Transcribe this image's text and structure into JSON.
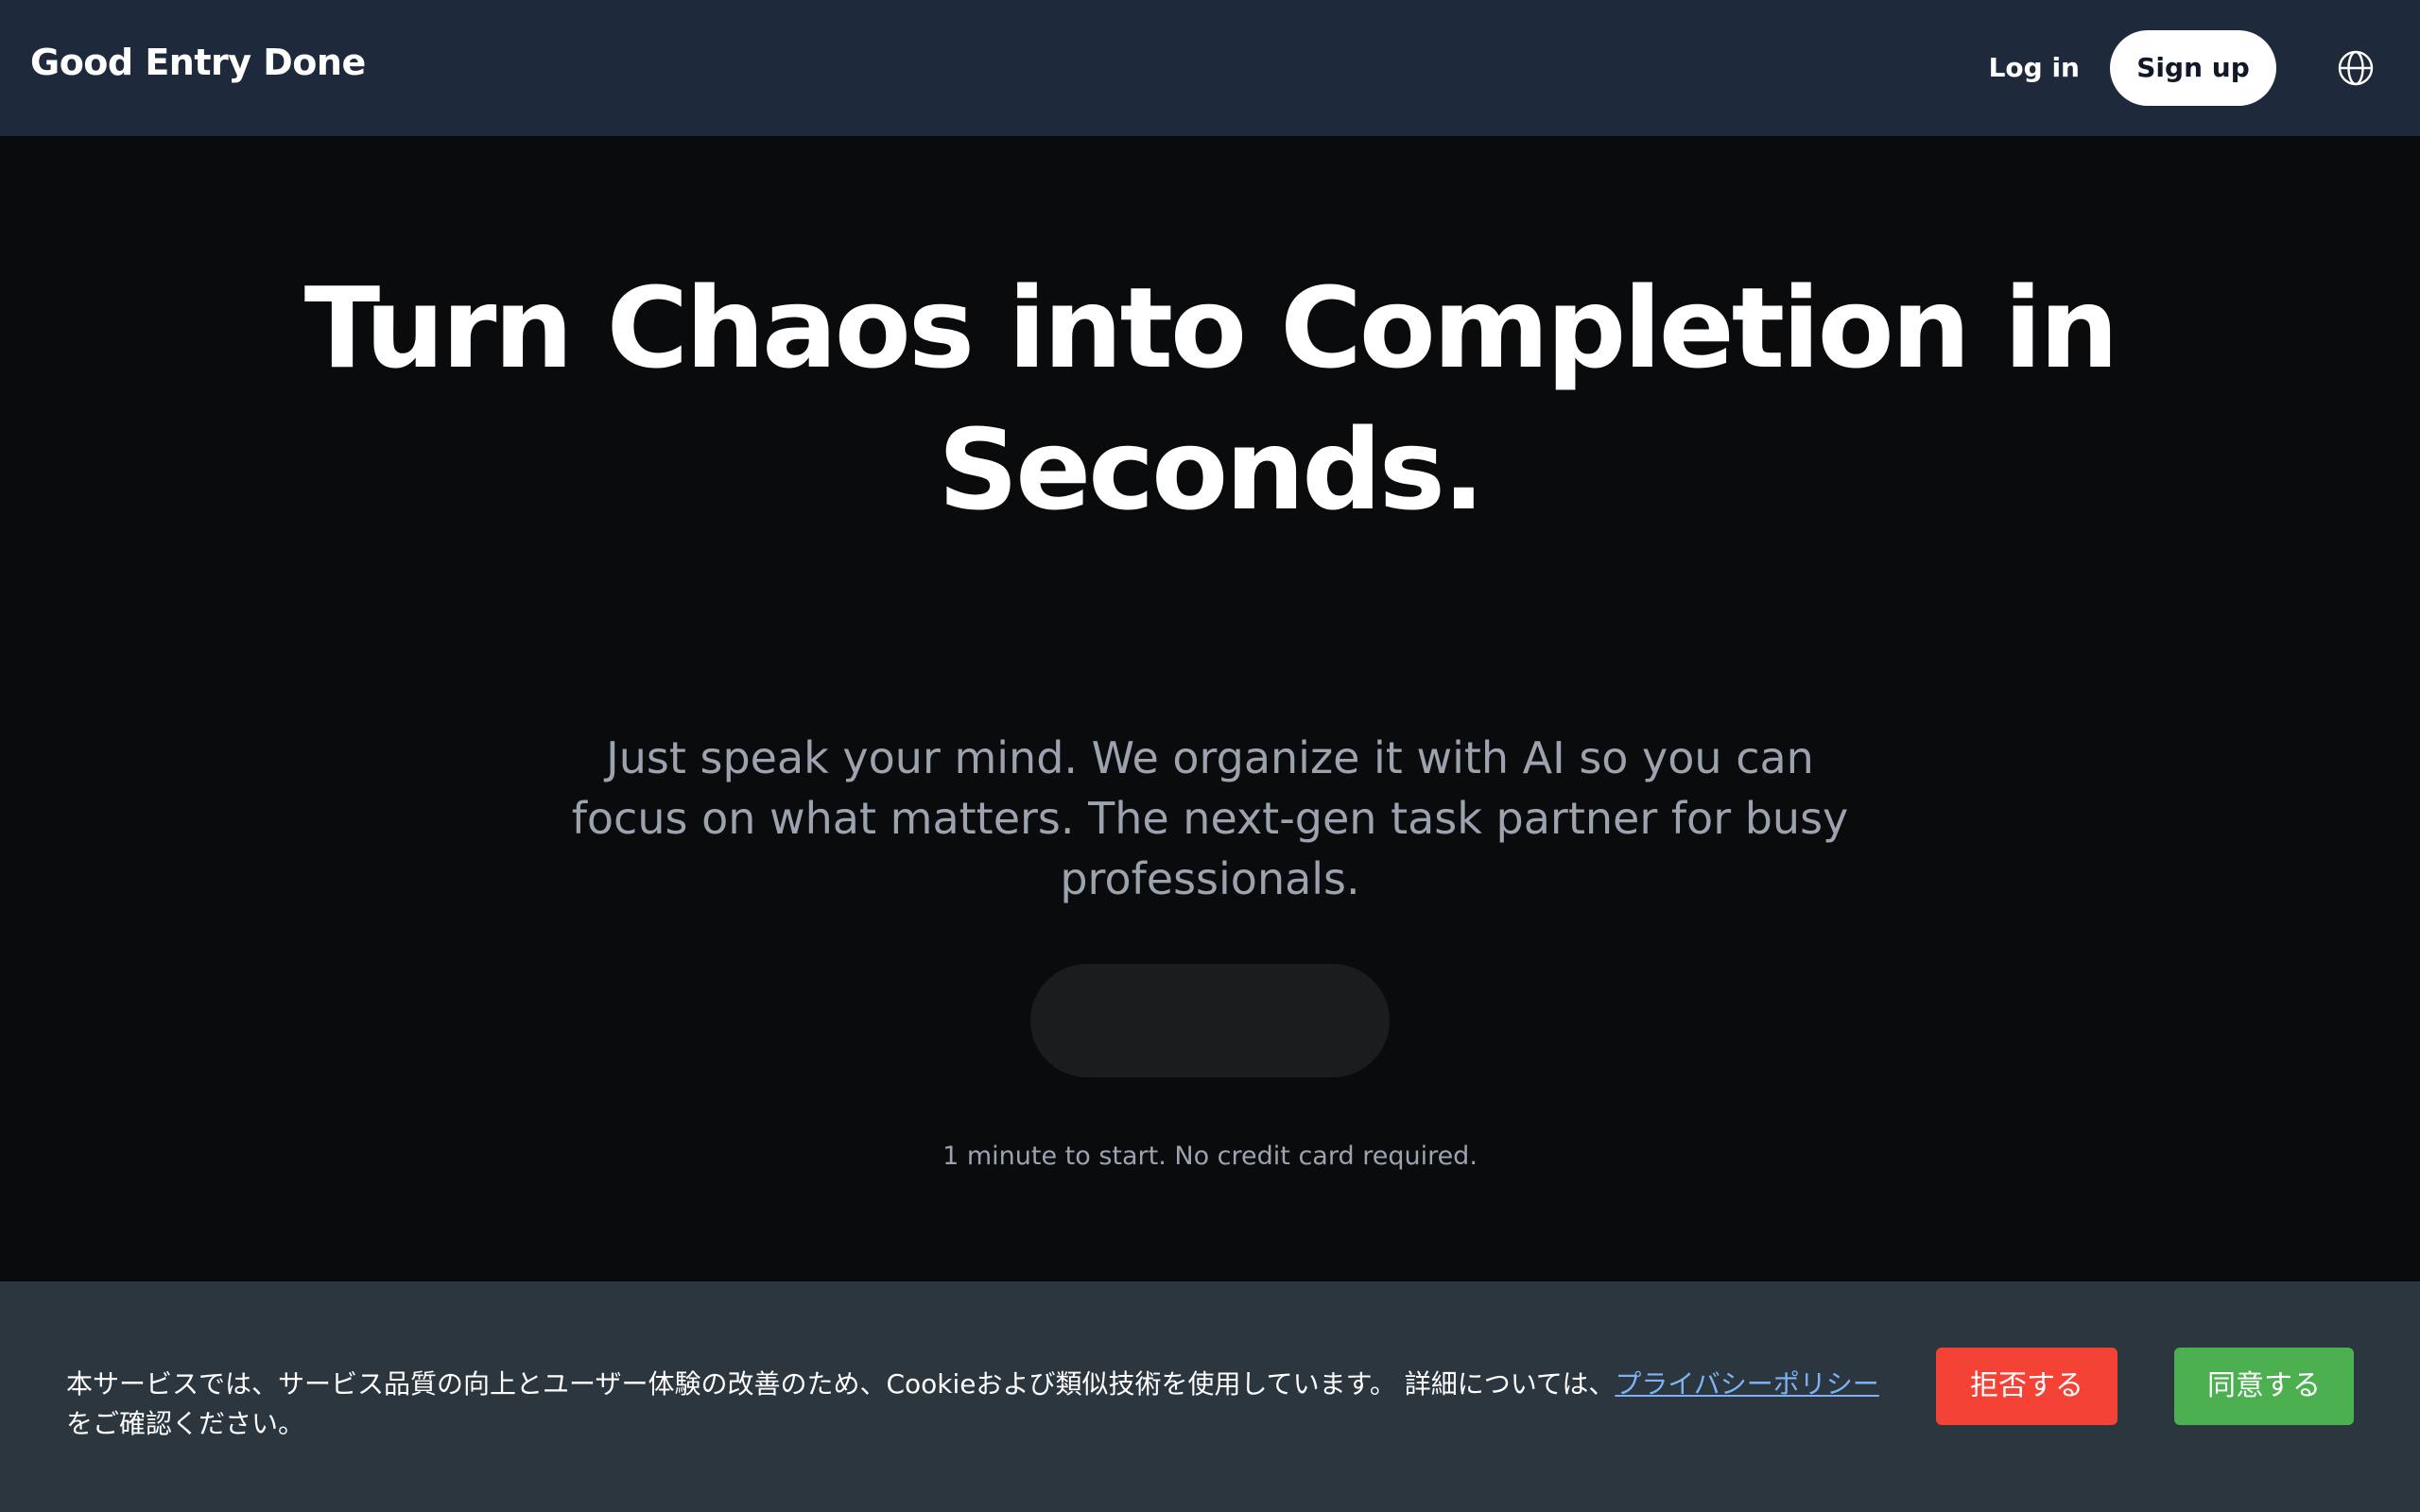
{
  "header": {
    "brand": "Good Entry Done",
    "login_label": "Log in",
    "signup_label": "Sign up",
    "language_icon": "globe-icon"
  },
  "hero": {
    "headline": "Turn Chaos into Completion in Seconds.",
    "subtext": "Just speak your mind. We organize it with AI so you can focus on what matters. The next-gen task partner for busy professionals.",
    "cta_label": "",
    "note": "1 minute to start. No credit card required."
  },
  "cookie": {
    "message": "本サービスでは、サービス品質の向上とユーザー体験の改善のため、Cookieおよび類似技術を使用しています。 詳細については、",
    "link_text": "プライバシーポリシー",
    "message_end": "をご確認ください。",
    "reject_label": "拒否する",
    "accept_label": "同意する"
  },
  "colors": {
    "header_bg": "#1e293b",
    "page_bg": "#0a0b0d",
    "banner_bg": "#2b363e",
    "reject": "#f44336",
    "accept": "#4caf50",
    "link": "#7fb2f5"
  }
}
